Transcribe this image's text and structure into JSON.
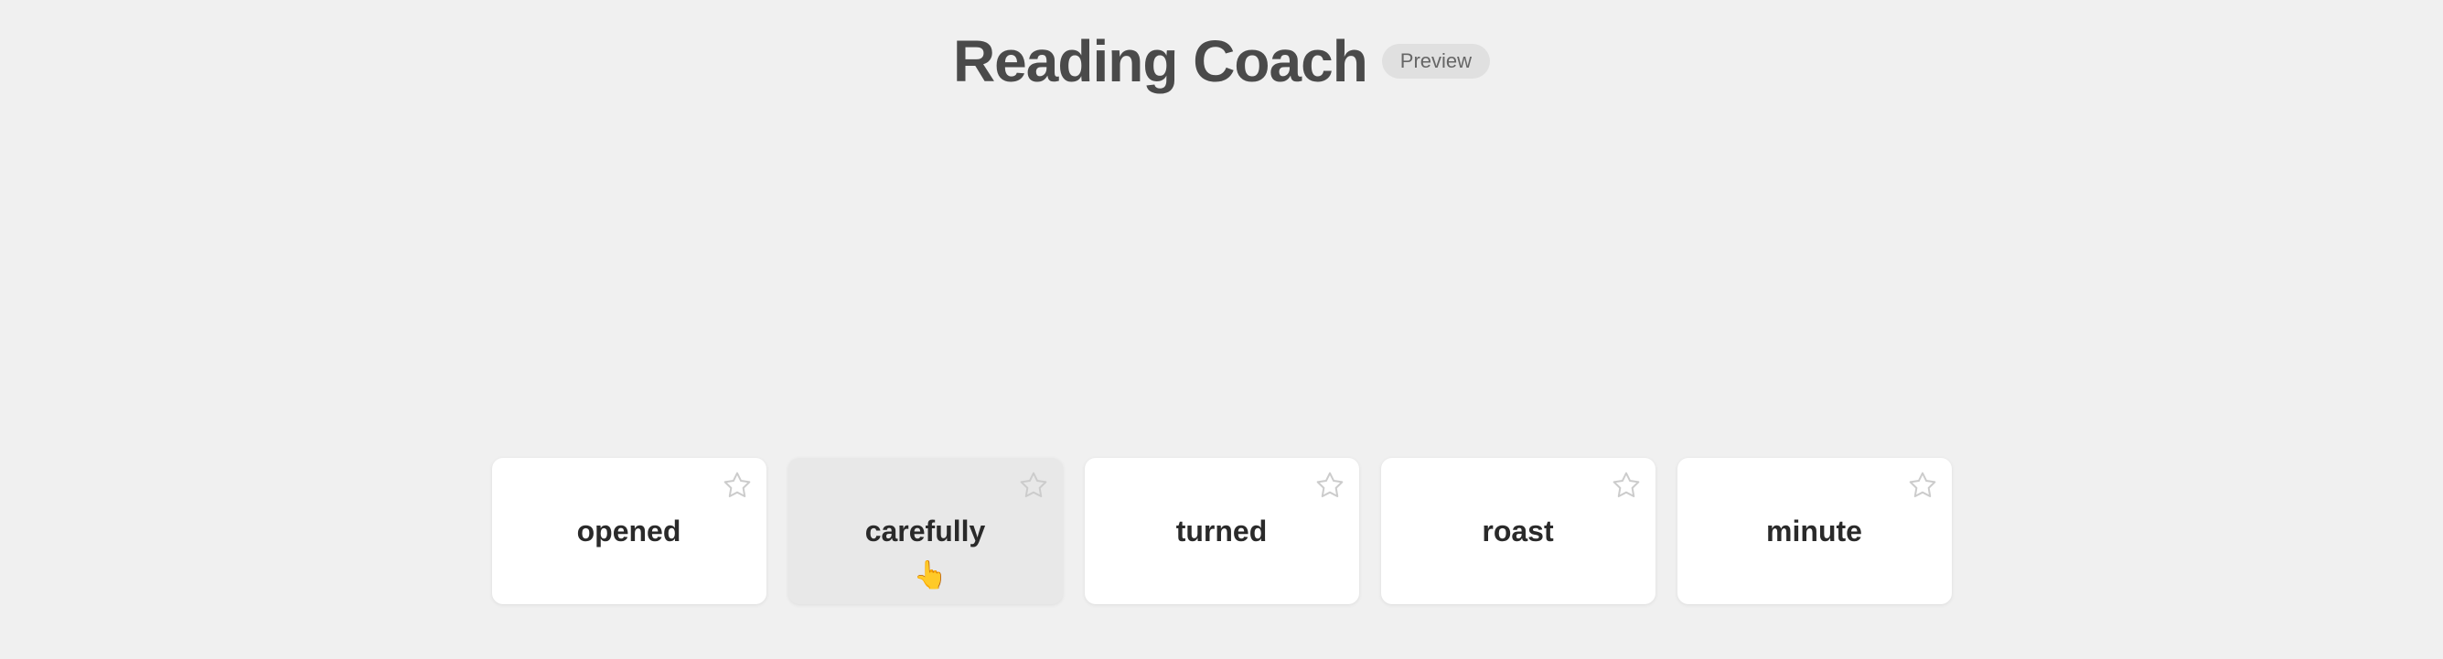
{
  "header": {
    "title": "Reading Coach",
    "preview_badge": "Preview"
  },
  "word_cards": [
    {
      "id": "opened",
      "label": "opened",
      "active": false
    },
    {
      "id": "carefully",
      "label": "carefully",
      "active": true
    },
    {
      "id": "turned",
      "label": "turned",
      "active": false
    },
    {
      "id": "roast",
      "label": "roast",
      "active": false
    },
    {
      "id": "minute",
      "label": "minute",
      "active": false
    }
  ],
  "icons": {
    "star": "☆",
    "cursor": "☞"
  }
}
